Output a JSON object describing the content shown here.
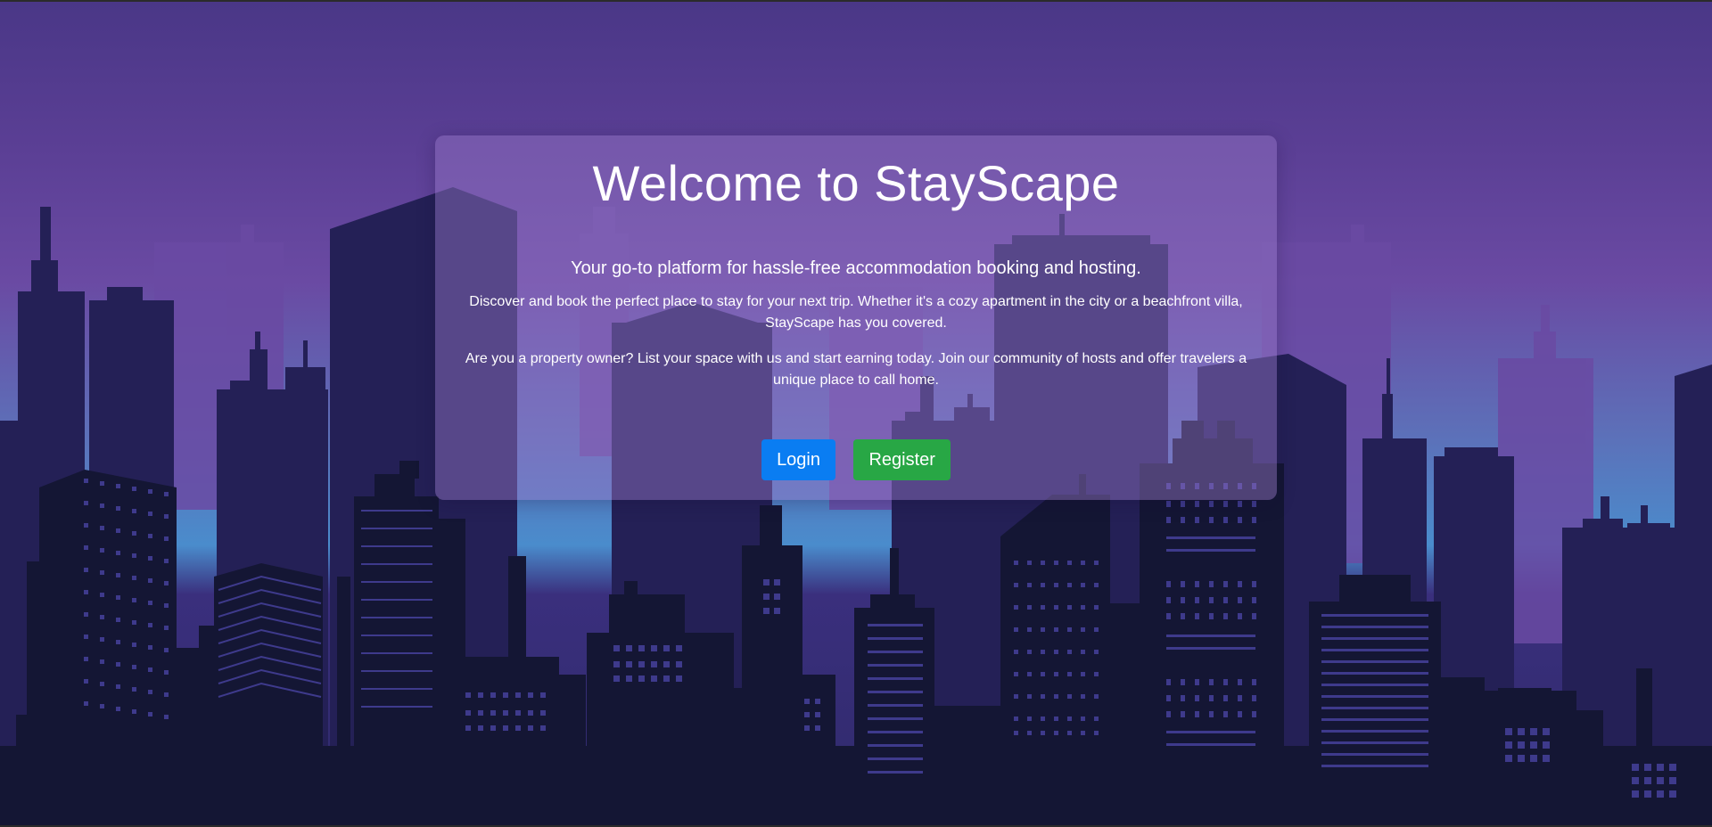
{
  "hero": {
    "title": "Welcome to StayScape",
    "subtitle": "Your go-to platform for hassle-free accommodation booking and hosting.",
    "paragraph1": "Discover and book the perfect place to stay for your next trip. Whether it's a cozy apartment in the city or a beachfront villa, StayScape has you covered.",
    "paragraph2": "Are you a property owner? List your space with us and start earning today. Join our community of hosts and offer travelers a unique place to call home."
  },
  "actions": {
    "login_label": "Login",
    "register_label": "Register"
  },
  "colors": {
    "login": "#0a7df2",
    "register": "#28a745",
    "card": "rgba(150,120,200,0.45)"
  }
}
